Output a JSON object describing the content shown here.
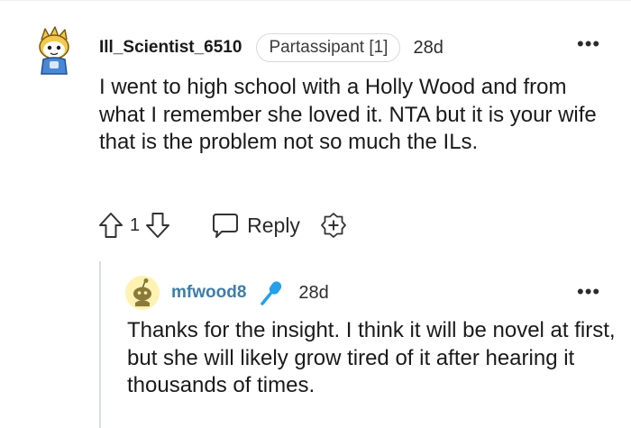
{
  "comments": [
    {
      "username": "Ill_Scientist_6510",
      "flair": "Partassipant [1]",
      "time": "28d",
      "body": "I went to high school with a Holly Wood and from what I remember she loved it. NTA but it is your wife that is the problem not so much the ILs.",
      "score": "1",
      "reply_label": "Reply",
      "avatar_icon": "snoo-avatar-icon",
      "more_icon": "more-options-icon"
    },
    {
      "username": "mfwood8",
      "op_badge_icon": "microphone-icon",
      "time": "28d",
      "body": "Thanks for the insight. I think it will be novel at first, but she will likely grow tired of it after hearing it thousands of times.",
      "avatar_icon": "snoo-avatar-icon",
      "more_icon": "more-options-icon"
    }
  ],
  "colors": {
    "text": "#1a1a1b",
    "op_username": "#3e7ea8",
    "mic_badge": "#24a0ed",
    "thread_line": "#dadcdf",
    "avatar2_bg": "#fff2b3"
  }
}
